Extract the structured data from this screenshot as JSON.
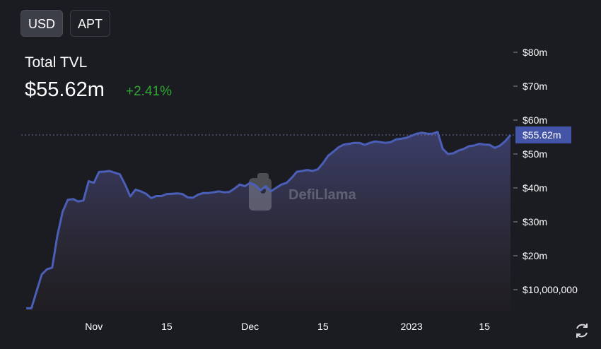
{
  "currency_toggle": {
    "options": [
      "USD",
      "APT"
    ],
    "selected": "USD"
  },
  "summary": {
    "label": "Total TVL",
    "value": "$55.62m",
    "change": "+2.41%"
  },
  "watermark": "DefiLlama",
  "colors": {
    "line": "#4b5fb8",
    "change_positive": "#2ea832",
    "badge": "#4455a8",
    "background": "#1b1c21"
  },
  "icons": {
    "refresh": "refresh-icon",
    "watermark_logo": "defillama-logo-icon"
  },
  "chart_data": {
    "type": "area",
    "title": "",
    "xlabel": "",
    "ylabel": "",
    "y_unit": "USD",
    "ylim": [
      4000000,
      80000000
    ],
    "y_ticks": [
      {
        "value": 80000000,
        "label": "$80m"
      },
      {
        "value": 70000000,
        "label": "$70m"
      },
      {
        "value": 60000000,
        "label": "$60m"
      },
      {
        "value": 50000000,
        "label": "$50m"
      },
      {
        "value": 40000000,
        "label": "$40m"
      },
      {
        "value": 30000000,
        "label": "$30m"
      },
      {
        "value": 20000000,
        "label": "$20m"
      },
      {
        "value": 10000000,
        "label": "$10,000,000"
      }
    ],
    "x_ticks": [
      {
        "date": "2022-11-01",
        "label": "Nov"
      },
      {
        "date": "2022-11-15",
        "label": "15"
      },
      {
        "date": "2022-12-01",
        "label": "Dec"
      },
      {
        "date": "2022-12-15",
        "label": "15"
      },
      {
        "date": "2023-01-01",
        "label": "2023"
      },
      {
        "date": "2023-01-15",
        "label": "15"
      }
    ],
    "current_value_label": "$55.62m",
    "current_value": 55620000,
    "grid": false,
    "series": [
      {
        "points": [
          [
            "2022-10-19",
            4.5
          ],
          [
            "2022-10-20",
            4.5
          ],
          [
            "2022-10-21",
            9.5
          ],
          [
            "2022-10-22",
            14.5
          ],
          [
            "2022-10-23",
            16.0
          ],
          [
            "2022-10-24",
            16.5
          ],
          [
            "2022-10-25",
            26.0
          ],
          [
            "2022-10-26",
            33.0
          ],
          [
            "2022-10-27",
            36.5
          ],
          [
            "2022-10-28",
            36.7
          ],
          [
            "2022-10-29",
            36.0
          ],
          [
            "2022-10-30",
            36.3
          ],
          [
            "2022-10-31",
            42.0
          ],
          [
            "2022-11-01",
            41.5
          ],
          [
            "2022-11-02",
            44.7
          ],
          [
            "2022-11-03",
            44.8
          ],
          [
            "2022-11-04",
            45.0
          ],
          [
            "2022-11-05",
            44.5
          ],
          [
            "2022-11-06",
            44.0
          ],
          [
            "2022-11-07",
            41.0
          ],
          [
            "2022-11-08",
            37.5
          ],
          [
            "2022-11-09",
            39.5
          ],
          [
            "2022-11-10",
            39.0
          ],
          [
            "2022-11-11",
            38.3
          ],
          [
            "2022-11-12",
            37.0
          ],
          [
            "2022-11-13",
            37.6
          ],
          [
            "2022-11-14",
            37.6
          ],
          [
            "2022-11-15",
            38.2
          ],
          [
            "2022-11-16",
            38.3
          ],
          [
            "2022-11-17",
            38.4
          ],
          [
            "2022-11-18",
            38.2
          ],
          [
            "2022-11-19",
            37.2
          ],
          [
            "2022-11-20",
            37.1
          ],
          [
            "2022-11-21",
            38.0
          ],
          [
            "2022-11-22",
            38.5
          ],
          [
            "2022-11-23",
            38.5
          ],
          [
            "2022-11-24",
            38.7
          ],
          [
            "2022-11-25",
            39.0
          ],
          [
            "2022-11-26",
            38.7
          ],
          [
            "2022-11-27",
            38.8
          ],
          [
            "2022-11-28",
            39.8
          ],
          [
            "2022-11-29",
            41.0
          ],
          [
            "2022-11-30",
            40.5
          ],
          [
            "2022-12-01",
            41.5
          ],
          [
            "2022-12-02",
            40.8
          ],
          [
            "2022-12-03",
            39.3
          ],
          [
            "2022-12-04",
            40.5
          ],
          [
            "2022-12-05",
            39.0
          ],
          [
            "2022-12-06",
            40.0
          ],
          [
            "2022-12-07",
            41.0
          ],
          [
            "2022-12-08",
            41.5
          ],
          [
            "2022-12-09",
            43.0
          ],
          [
            "2022-12-10",
            44.8
          ],
          [
            "2022-12-11",
            45.0
          ],
          [
            "2022-12-12",
            45.3
          ],
          [
            "2022-12-13",
            45.0
          ],
          [
            "2022-12-14",
            45.5
          ],
          [
            "2022-12-15",
            47.3
          ],
          [
            "2022-12-16",
            49.5
          ],
          [
            "2022-12-17",
            50.7
          ],
          [
            "2022-12-18",
            52.0
          ],
          [
            "2022-12-19",
            52.8
          ],
          [
            "2022-12-20",
            53.0
          ],
          [
            "2022-12-21",
            53.3
          ],
          [
            "2022-12-22",
            53.3
          ],
          [
            "2022-12-23",
            52.7
          ],
          [
            "2022-12-24",
            53.3
          ],
          [
            "2022-12-25",
            53.7
          ],
          [
            "2022-12-26",
            53.5
          ],
          [
            "2022-12-27",
            53.3
          ],
          [
            "2022-12-28",
            53.5
          ],
          [
            "2022-12-29",
            54.3
          ],
          [
            "2022-12-30",
            54.5
          ],
          [
            "2022-12-31",
            54.8
          ],
          [
            "2023-01-01",
            55.4
          ],
          [
            "2023-01-02",
            56.0
          ],
          [
            "2023-01-03",
            56.3
          ],
          [
            "2023-01-04",
            56.0
          ],
          [
            "2023-01-05",
            56.0
          ],
          [
            "2023-01-06",
            56.5
          ],
          [
            "2023-01-07",
            51.5
          ],
          [
            "2023-01-08",
            50.0
          ],
          [
            "2023-01-09",
            50.2
          ],
          [
            "2023-01-10",
            51.0
          ],
          [
            "2023-01-11",
            51.5
          ],
          [
            "2023-01-12",
            52.3
          ],
          [
            "2023-01-13",
            52.5
          ],
          [
            "2023-01-14",
            53.0
          ],
          [
            "2023-01-15",
            52.8
          ],
          [
            "2023-01-16",
            52.7
          ],
          [
            "2023-01-17",
            51.8
          ],
          [
            "2023-01-18",
            52.5
          ],
          [
            "2023-01-19",
            53.8
          ],
          [
            "2023-01-20",
            55.62
          ]
        ],
        "y_scale_note_units": "millions USD"
      }
    ]
  }
}
